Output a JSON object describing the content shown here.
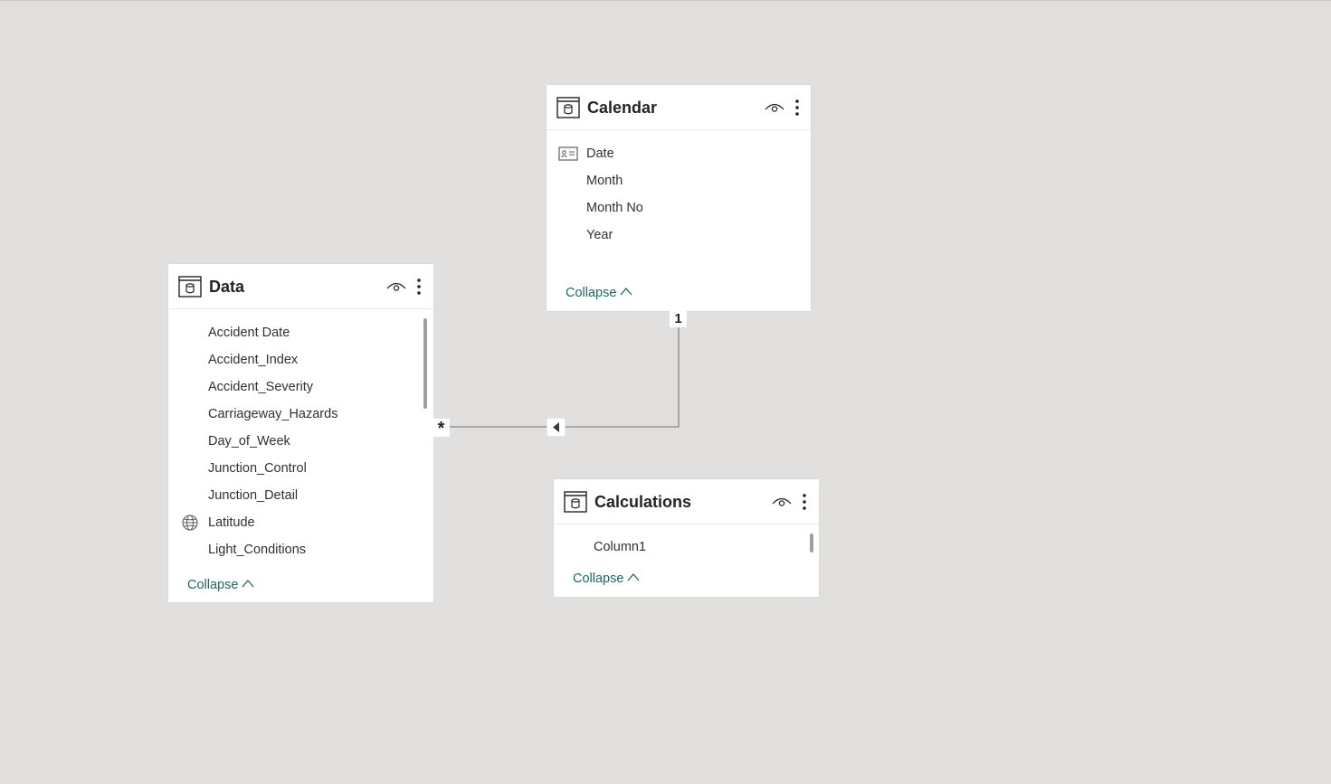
{
  "tables": {
    "calendar": {
      "title": "Calendar",
      "fields": [
        "Date",
        "Month",
        "Month No",
        "Year"
      ],
      "collapse_label": "Collapse"
    },
    "data": {
      "title": "Data",
      "fields": [
        "Accident Date",
        "Accident_Index",
        "Accident_Severity",
        "Carriageway_Hazards",
        "Day_of_Week",
        "Junction_Control",
        "Junction_Detail",
        "Latitude",
        "Light_Conditions"
      ],
      "collapse_label": "Collapse"
    },
    "calculations": {
      "title": "Calculations",
      "fields": [
        "Column1"
      ],
      "collapse_label": "Collapse"
    }
  },
  "relationship": {
    "one_side_label": "1",
    "many_side_label": "*"
  },
  "colors": {
    "canvas": "#e1e0de",
    "card": "#ffffff",
    "accent_link": "#1c6a62",
    "line": "#8a8886"
  },
  "icons": {
    "table": "table-icon",
    "visibility": "eye-icon",
    "more": "more-options-icon",
    "date_field": "calendar-field-icon",
    "geo_field": "globe-icon",
    "collapse": "chevron-up-icon"
  }
}
